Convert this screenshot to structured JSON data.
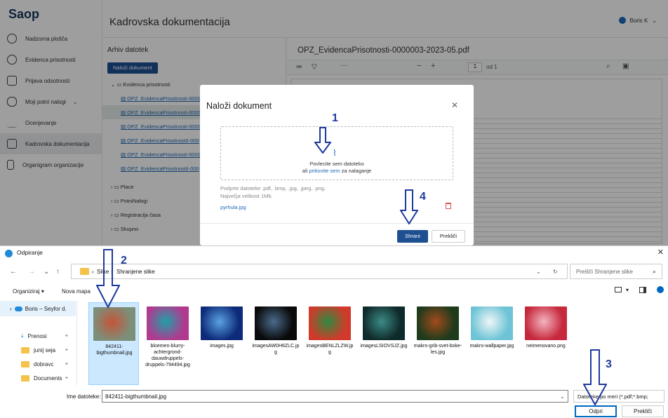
{
  "app": {
    "logo": "Saop",
    "page_title": "Kadrovska dokumentacija",
    "user": "Boris K",
    "sidebar": [
      {
        "label": "Nadzorna plošča",
        "icon": "dashboard-icon"
      },
      {
        "label": "Evidenca prisotnosti",
        "icon": "clock-icon"
      },
      {
        "label": "Prijava odsotnosti",
        "icon": "calendar-icon"
      },
      {
        "label": "Moji potni nalogi",
        "icon": "car-icon"
      },
      {
        "label": "Ocenjevanje",
        "icon": "rating-icon"
      },
      {
        "label": "Kadrovska dokumentacija",
        "icon": "folder-icon"
      },
      {
        "label": "Organigram organizacije",
        "icon": "org-chart-icon"
      }
    ]
  },
  "archive": {
    "title": "Arhiv datotek",
    "upload_button": "Naloži dokument",
    "tree": [
      {
        "label": "Evidenca prisotnosti",
        "type": "folder-open"
      },
      {
        "label": "OPZ_EvidencaPrisotnosti-0000",
        "type": "file"
      },
      {
        "label": "OPZ_EvidencaPrisotnosti-0000",
        "type": "file"
      },
      {
        "label": "OPZ_EvidencaPrisotnosti-0000",
        "type": "file"
      },
      {
        "label": "OPZ_EvidencaPrisotnostiI-000",
        "type": "file"
      },
      {
        "label": "OPZ_EvidencaPrisotnosti-0000",
        "type": "file"
      },
      {
        "label": "OPZ_EvidencaPrisotnostiI-000",
        "type": "file"
      },
      {
        "label": "Place",
        "type": "folder"
      },
      {
        "label": "PotniNalogi",
        "type": "folder"
      },
      {
        "label": "Registracija časa",
        "type": "folder"
      },
      {
        "label": "Skupno",
        "type": "folder"
      }
    ]
  },
  "pdf": {
    "title": "OPZ_EvidencaPrisotnosti-0000003-2023-05.pdf",
    "page_current": "1",
    "page_total": "od 1"
  },
  "modal": {
    "title": "Naloži dokument",
    "dropzone_line1": "Povlecite sem datoteko",
    "dropzone_line2_prefix": "ali",
    "dropzone_link": "pritisnite sem",
    "dropzone_line2_suffix": "za nalaganje",
    "hint_types": "Podprte datoteke .pdf, .bmp, .jpg, .jpeg, .png.",
    "hint_size": "Največja velikost 1Mb.",
    "selected_file": "pyrhula.jpg",
    "save_button": "Shrani",
    "cancel_button": "Prekliči"
  },
  "dialog": {
    "title": "Odpiranje",
    "breadcrumb": [
      "Slike",
      "Shranjene slike"
    ],
    "search_placeholder": "Preišči Shranjene slike",
    "organize": "Organiziraj ▾",
    "new_folder": "Nova mapa",
    "nav": [
      {
        "label": "Boris – Seyfor d.",
        "cloud": true
      },
      {
        "label": "Prenosi",
        "download": true
      },
      {
        "label": "junij seja"
      },
      {
        "label": "dobravc"
      },
      {
        "label": "Documents"
      }
    ],
    "files": [
      {
        "name": "842411-bigthumbnail.jpg",
        "colors": [
          "#7c8f79",
          "#c4553a"
        ],
        "selected": true
      },
      {
        "name": "bloemen-blurry-achtergrond-dauwdruppels-druppels-794494.jpg",
        "colors": [
          "#b03a8e",
          "#1fa0a9"
        ]
      },
      {
        "name": "images.jpg",
        "colors": [
          "#0d2b7a",
          "#5ba2e0"
        ]
      },
      {
        "name": "imagesAW0H6ZLC.jpg",
        "colors": [
          "#0a0a0a",
          "#4a6b8c"
        ]
      },
      {
        "name": "imagesBENLZLZW.jpg",
        "colors": [
          "#d13a2a",
          "#2f8a3f"
        ]
      },
      {
        "name": "imagesLSIOVSJZ.jpg",
        "colors": [
          "#0f2a2a",
          "#3b8b86"
        ]
      },
      {
        "name": "makro-grib-svet-boke-les.jpg",
        "colors": [
          "#1e3b1c",
          "#a34a1c"
        ]
      },
      {
        "name": "makro-wallpaper.jpg",
        "colors": [
          "#6ec4d6",
          "#f0f6f7"
        ]
      },
      {
        "name": "neimenovano.png",
        "colors": [
          "#c6283c",
          "#f3b4bf"
        ]
      }
    ],
    "filename_label": "Ime datoteke:",
    "filename_value": "842411-bigthumbnail.jpg",
    "filetype": "Datoteke po meri (*.pdf;*.bmp;",
    "open_button": "Odpri",
    "cancel_button": "Prekliči"
  },
  "annotations": [
    "1",
    "2",
    "3",
    "4"
  ],
  "colors": {
    "brand": "#1d4f91",
    "link": "#1f69b8",
    "arrow": "#1e3a9c"
  }
}
